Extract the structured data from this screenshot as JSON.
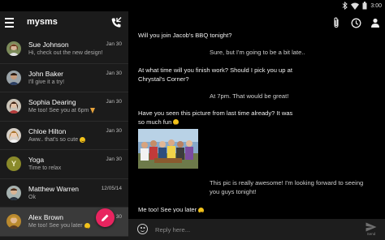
{
  "status_bar": {
    "time": "3:00"
  },
  "sidebar": {
    "title": "mysms",
    "conversations": [
      {
        "name": "Sue Johnson",
        "date": "Jan 30",
        "preview": "Hi, check out the new design!",
        "emoji": ""
      },
      {
        "name": "John Baker",
        "date": "Jan 30",
        "preview": "I'll give it a try!",
        "emoji": ""
      },
      {
        "name": "Sophia Dearing",
        "date": "Jan 30",
        "preview": "Me too! See you at 6pm",
        "emoji": "pizza"
      },
      {
        "name": "Chloe Hilton",
        "date": "Jan 30",
        "preview": "Aww.. that's so cute",
        "emoji": "smile"
      },
      {
        "name": "Yoga",
        "date": "Jan 30",
        "preview": "Time to relax",
        "emoji": "",
        "initial": "Y"
      },
      {
        "name": "Matthew Warren",
        "date": "12/05/14",
        "preview": "Ok",
        "emoji": ""
      },
      {
        "name": "Alex Brown",
        "date": "Jan 30",
        "preview": "Me too! See you later",
        "emoji": "smile"
      }
    ]
  },
  "thread": {
    "messages": [
      {
        "dir": "in",
        "lines": [
          "Will you join Jacob's BBQ tonight?"
        ]
      },
      {
        "dir": "out",
        "lines": [
          "Sure, but I'm going to be a bit late.."
        ]
      },
      {
        "dir": "in",
        "lines": [
          "At what time will you finish work? Should I pick you up at",
          "Chrystal's Corner?"
        ]
      },
      {
        "dir": "out",
        "lines": [
          "At 7pm. That would be great!"
        ]
      },
      {
        "dir": "in",
        "lines": [
          "Have you seen this picture from last time already? It was",
          "so much fun"
        ]
      },
      {
        "dir": "out",
        "lines": [
          "This pic is really awesome! I'm looking forward to seeing",
          "you guys tonight!"
        ]
      },
      {
        "dir": "in",
        "lines": [
          "Me too! See you later"
        ]
      }
    ]
  },
  "composer": {
    "placeholder": "Reply here...",
    "send_label": "Send"
  },
  "colors": {
    "accent": "#e8245f",
    "sidebar_bg": "#1b1b1b",
    "selected_bg": "#3a3a3a"
  }
}
